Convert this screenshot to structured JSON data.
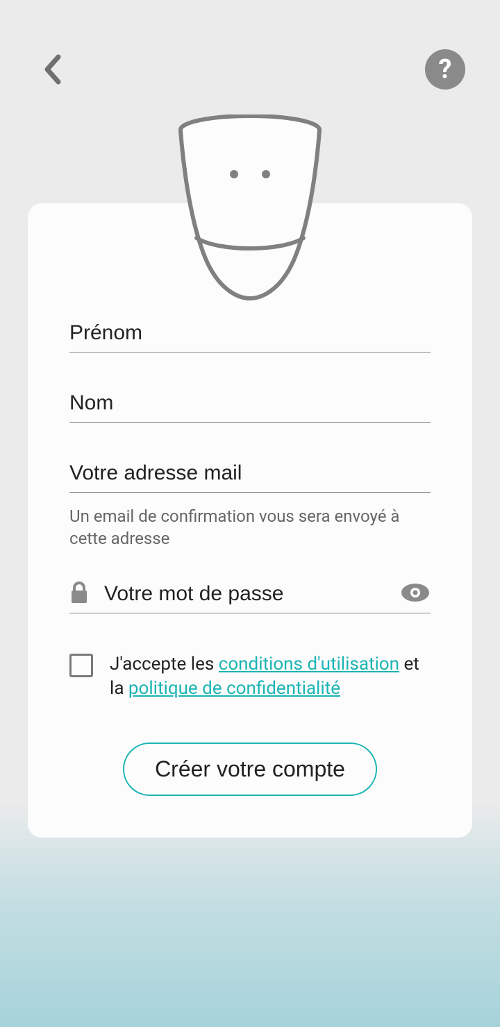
{
  "form": {
    "firstname_placeholder": "Prénom",
    "lastname_placeholder": "Nom",
    "email_placeholder": "Votre adresse mail",
    "email_helper": "Un email de confirmation vous sera envoyé à cette adresse",
    "password_placeholder": "Votre mot de passe",
    "consent_prefix": "J'accepte les ",
    "consent_terms": "conditions d'utilisation",
    "consent_middle": " et la ",
    "consent_privacy": "politique de confidentialité",
    "submit_label": "Créer votre compte"
  },
  "icons": {
    "back": "chevron-left",
    "help": "question",
    "lock": "lock",
    "eye": "eye"
  },
  "accent_color": "#1AB5B3"
}
